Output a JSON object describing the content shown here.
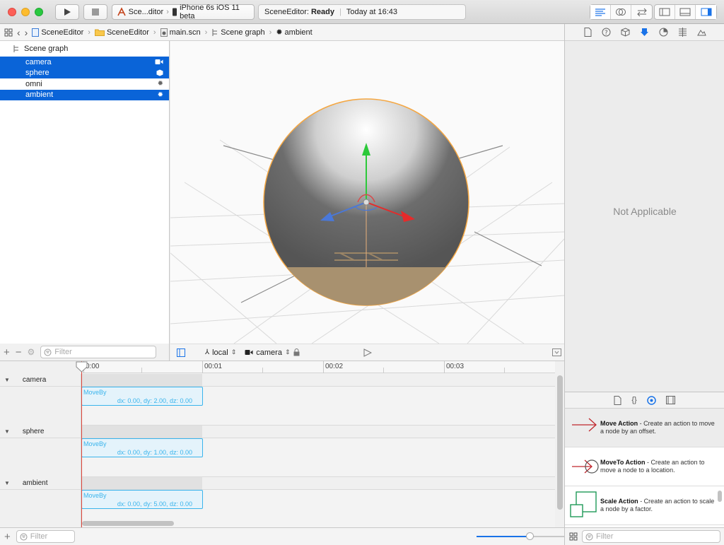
{
  "toolbar": {
    "scheme_name": "Sce...ditor",
    "destination": "iPhone 6s iOS 11 beta",
    "status_project": "SceneEditor:",
    "status_state": "Ready",
    "status_time": "Today at 16:43"
  },
  "jumpbar": {
    "crumbs": [
      "SceneEditor",
      "SceneEditor",
      "main.scn",
      "Scene graph",
      "ambient"
    ]
  },
  "scene_graph": {
    "title": "Scene graph",
    "nodes": [
      {
        "label": "camera",
        "icon": "camera-icon",
        "selected": true
      },
      {
        "label": "sphere",
        "icon": "cube-icon",
        "selected": true
      },
      {
        "label": "omni",
        "icon": "sun-icon",
        "selected": false
      },
      {
        "label": "ambient",
        "icon": "sun-icon",
        "selected": true
      }
    ],
    "filter_placeholder": "Filter"
  },
  "viewport": {
    "space_mode": "local",
    "point_of_view": "camera"
  },
  "timeline": {
    "ticks": [
      "0:00",
      "00:01",
      "00:02",
      "00:03"
    ],
    "tracks": [
      {
        "name": "camera",
        "action_title": "MoveBy",
        "action_params": "dx: 0.00, dy: 2.00, dz: 0.00"
      },
      {
        "name": "sphere",
        "action_title": "MoveBy",
        "action_params": "dx: 0.00, dy: 1.00, dz: 0.00"
      },
      {
        "name": "ambient",
        "action_title": "MoveBy",
        "action_params": "dx: 0.00, dy: 5.00, dz: 0.00"
      }
    ],
    "filter_placeholder": "Filter",
    "zoom": 0.6
  },
  "inspector": {
    "placeholder": "Not Applicable"
  },
  "library": {
    "items": [
      {
        "title": "Move Action",
        "desc": " - Create an action to move a node by an offset."
      },
      {
        "title": "MoveTo Action",
        "desc": " - Create an action to move a node to a location."
      },
      {
        "title": "Scale Action",
        "desc": " - Create an action to scale a node by a factor."
      }
    ],
    "filter_placeholder": "Filter"
  },
  "colors": {
    "selection": "#0a64d8",
    "action_blue": "#3ab4ec",
    "playhead": "#e0473c",
    "sphere_outline": "#f5a742"
  }
}
